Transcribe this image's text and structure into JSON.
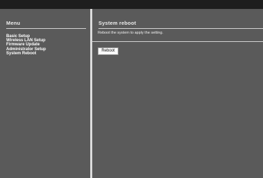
{
  "sidebar": {
    "title": "Menu",
    "items": [
      {
        "label": "Basic Setup"
      },
      {
        "label": "Wireless LAN Setup"
      },
      {
        "label": "Firmware Update"
      },
      {
        "label": "Administrator Setup"
      },
      {
        "label": "System Reboot"
      }
    ]
  },
  "main": {
    "title": "System reboot",
    "description": "Reboot the system to apply the setting.",
    "reboot_button_label": "Reboot"
  },
  "colors": {
    "background": "#5a5a5a",
    "top_bar": "#1e1e1e",
    "divider": "#dcdcdc",
    "text": "#ffffff"
  }
}
